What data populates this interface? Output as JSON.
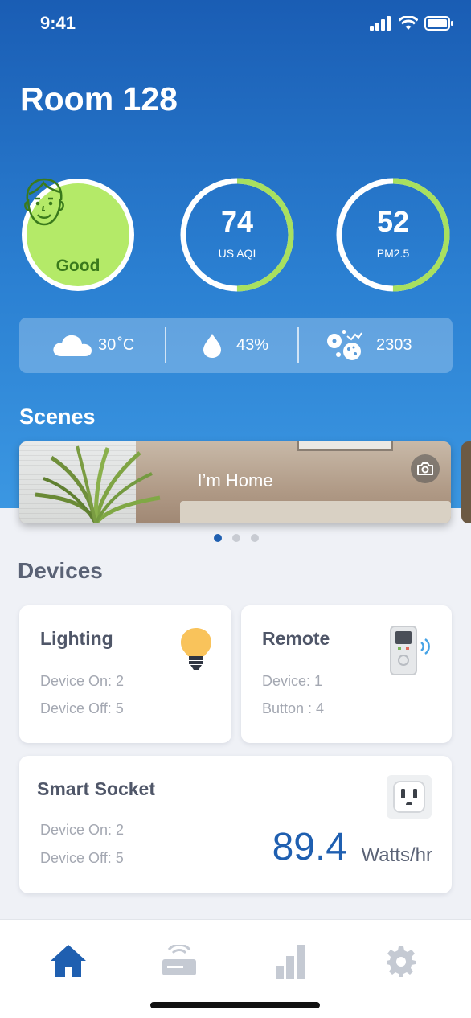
{
  "status_bar": {
    "time": "9:41"
  },
  "room": {
    "title": "Room 128"
  },
  "air_quality": {
    "overall": {
      "label": "Good",
      "color": "#b4ea68"
    },
    "aqi": {
      "value": "74",
      "label": "US AQI",
      "progress": 0.5
    },
    "pm25": {
      "value": "52",
      "label": "PM2.5",
      "progress": 0.5
    },
    "ring_color": "#a8e05f"
  },
  "weather": {
    "temperature": "30",
    "temperature_unit": "˚C",
    "humidity": "43%",
    "particles": "2303"
  },
  "scenes": {
    "title": "Scenes",
    "items": [
      {
        "name": "I’m Home"
      }
    ],
    "page_count": 3,
    "active_page": 0
  },
  "devices": {
    "title": "Devices",
    "lighting": {
      "title": "Lighting",
      "line1": "Device On: 2",
      "line2": "Device Off: 5"
    },
    "remote": {
      "title": "Remote",
      "line1": "Device: 1",
      "line2": "Button : 4"
    },
    "socket": {
      "title": "Smart Socket",
      "line1": "Device On: 2",
      "line2": "Device Off: 5",
      "power": "89.4",
      "power_unit": "Watts/hr"
    }
  },
  "tabbar": {
    "items": [
      {
        "icon": "home-icon",
        "active": true
      },
      {
        "icon": "router-icon",
        "active": false
      },
      {
        "icon": "bar-chart-icon",
        "active": false
      },
      {
        "icon": "gear-icon",
        "active": false
      }
    ],
    "active_color": "#1f5fb0",
    "inactive_color": "#c5cad3"
  }
}
